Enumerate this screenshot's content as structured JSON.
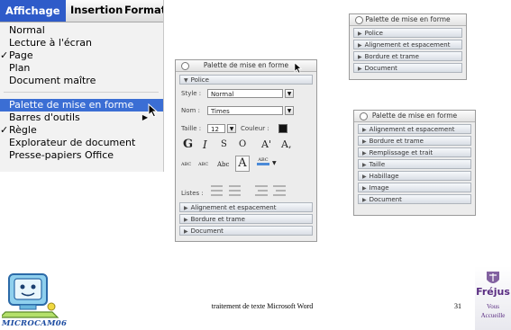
{
  "menu_screenshot": {
    "menubar": [
      "Affichage",
      "Insertion",
      "Format"
    ],
    "items": [
      {
        "label": "Normal",
        "checked": false,
        "submenu": false,
        "highlighted": false
      },
      {
        "label": "Lecture à l'écran",
        "checked": false,
        "submenu": false,
        "highlighted": false
      },
      {
        "label": "Page",
        "checked": true,
        "submenu": false,
        "highlighted": false
      },
      {
        "label": "Plan",
        "checked": false,
        "submenu": false,
        "highlighted": false
      },
      {
        "label": "Document maître",
        "checked": false,
        "submenu": false,
        "highlighted": false
      },
      {
        "label": "Palette de mise en forme",
        "checked": false,
        "submenu": false,
        "highlighted": true
      },
      {
        "label": "Barres d'outils",
        "checked": false,
        "submenu": true,
        "highlighted": false
      },
      {
        "label": "Règle",
        "checked": true,
        "submenu": false,
        "highlighted": false
      },
      {
        "label": "Explorateur de document",
        "checked": false,
        "submenu": false,
        "highlighted": false
      },
      {
        "label": "Presse-papiers Office",
        "checked": false,
        "submenu": false,
        "highlighted": false
      }
    ],
    "check_glyph": "✓",
    "submenu_glyph": "▶"
  },
  "palette_expanded": {
    "title": "Palette de mise en forme",
    "police_header": "Police",
    "style_label": "Style :",
    "style_value": "Normal",
    "nom_label": "Nom :",
    "nom_value": "Times",
    "taille_label": "Taille :",
    "taille_value": "12",
    "couleur_label": "Couleur :",
    "format_row1": [
      "G",
      "I",
      "S",
      "O",
      "A'",
      "A,"
    ],
    "format_row2": [
      "ABC",
      "ABC",
      "Abc",
      "A",
      "ABC"
    ],
    "listes_label": "Listes :",
    "sections": [
      "Alignement et espacement",
      "Bordure et trame",
      "Document"
    ]
  },
  "palette_small": {
    "title": "Palette de mise en forme",
    "sections": [
      "Police",
      "Alignement et espacement",
      "Bordure et trame",
      "Document"
    ]
  },
  "palette_image": {
    "title": "Palette de mise en forme",
    "sections": [
      "Alignement et espacement",
      "Bordure et trame",
      "Remplissage et trait",
      "Taille",
      "Habillage",
      "Image",
      "Document"
    ]
  },
  "footer": {
    "caption": "traitement de texte Microsoft Word",
    "page_number": "31"
  },
  "logo": {
    "text": "MICROCAM06"
  },
  "frejus_badge": {
    "title": "Fréjus",
    "line1": "Vous",
    "line2": "Accueille"
  },
  "colors": {
    "menu_highlight": "#3b6ed4",
    "menubar_active": "#2e5bc9",
    "logo_blue": "#1a4aa0",
    "frejus_purple": "#5a2d82"
  }
}
